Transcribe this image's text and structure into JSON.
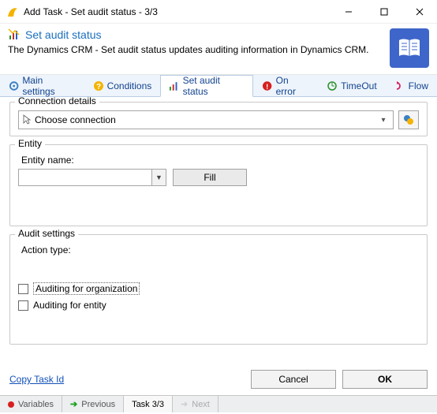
{
  "window": {
    "title": "Add Task - Set audit status - 3/3"
  },
  "header": {
    "title": "Set audit status",
    "description": "The Dynamics CRM - Set audit status updates auditing information in Dynamics CRM."
  },
  "tabs": {
    "main": "Main settings",
    "conditions": "Conditions",
    "audit": "Set audit status",
    "onerror": "On error",
    "timeout": "TimeOut",
    "flow": "Flow"
  },
  "groups": {
    "connection": {
      "legend": "Connection details",
      "selectText": "Choose connection"
    },
    "entity": {
      "legend": "Entity",
      "nameLabel": "Entity name:",
      "nameValue": "",
      "fillLabel": "Fill"
    },
    "audit": {
      "legend": "Audit settings",
      "actionTypeLabel": "Action type:",
      "orgLabel": "Auditing for organization",
      "entityLabel": "Auditing for entity"
    }
  },
  "bottom": {
    "copyLink": "Copy Task Id",
    "cancel": "Cancel",
    "ok": "OK"
  },
  "status": {
    "variables": "Variables",
    "previous": "Previous",
    "task": "Task 3/3",
    "next": "Next"
  }
}
